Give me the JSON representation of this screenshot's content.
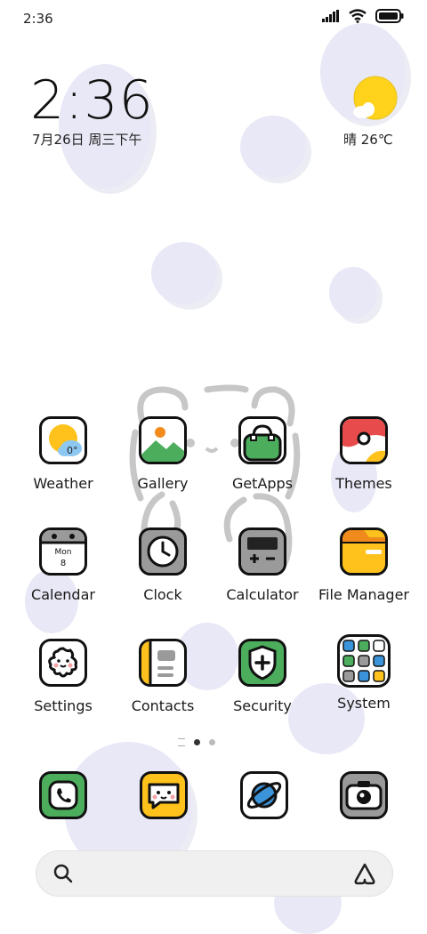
{
  "status_bar": {
    "time": "2:36"
  },
  "clock": {
    "time": "2:36",
    "date": "7月26日 周三下午"
  },
  "weather_widget": {
    "text": "晴 26℃"
  },
  "apps": [
    {
      "label": "Weather"
    },
    {
      "label": "Gallery"
    },
    {
      "label": "GetApps"
    },
    {
      "label": "Themes"
    },
    {
      "label": "Calendar"
    },
    {
      "label": "Clock"
    },
    {
      "label": "Calculator"
    },
    {
      "label": "File Manager"
    },
    {
      "label": "Settings"
    },
    {
      "label": "Contacts"
    },
    {
      "label": "Security"
    },
    {
      "label": "System"
    }
  ],
  "weather_icon_temp": "0°",
  "calendar_icon": {
    "weekday": "Mon",
    "day": "8"
  },
  "dock": [
    {
      "icon": "phone-icon"
    },
    {
      "icon": "messaging-icon"
    },
    {
      "icon": "browser-icon"
    },
    {
      "icon": "camera-icon"
    }
  ],
  "page_indicator": {
    "pages": 2,
    "current": 1
  },
  "colors": {
    "bubble": "#e9e8f6",
    "sun": "#ffd21c",
    "green": "#4cae5c",
    "blue": "#3b93d9",
    "red": "#e84b4b"
  }
}
